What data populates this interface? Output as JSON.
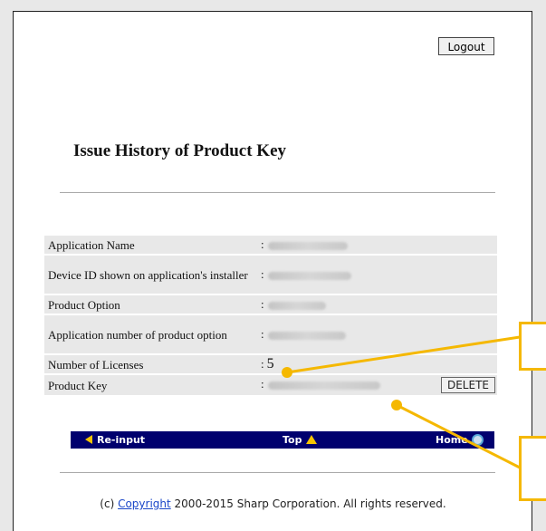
{
  "header": {
    "logout_label": "Logout"
  },
  "page": {
    "title": "Issue History of Product Key"
  },
  "info_rows": [
    {
      "label": "Application Name",
      "separator": ":"
    },
    {
      "label": "Device ID shown on application's installer",
      "separator": ":"
    },
    {
      "label": "Product Option",
      "separator": ":"
    },
    {
      "label": "Application number of product option",
      "separator": ":"
    },
    {
      "label": "Number of Licenses",
      "separator": ":",
      "value": "5"
    },
    {
      "label": "Product Key",
      "separator": ":"
    }
  ],
  "actions": {
    "delete_label": "DELETE"
  },
  "nav": {
    "reinput_label": "Re-input",
    "top_label": "Top",
    "home_label": "Home"
  },
  "footer": {
    "prefix": "(c) ",
    "link": "Copyright",
    "suffix": " 2000-2015 Sharp Corporation. All rights reserved."
  },
  "colors": {
    "nav_bg": "#00006e",
    "accent": "#f5b800",
    "row_bg": "#e8e8e8"
  },
  "icons": {
    "reinput": "triangle-left-icon",
    "top": "triangle-up-icon",
    "home": "home-globe-icon"
  }
}
